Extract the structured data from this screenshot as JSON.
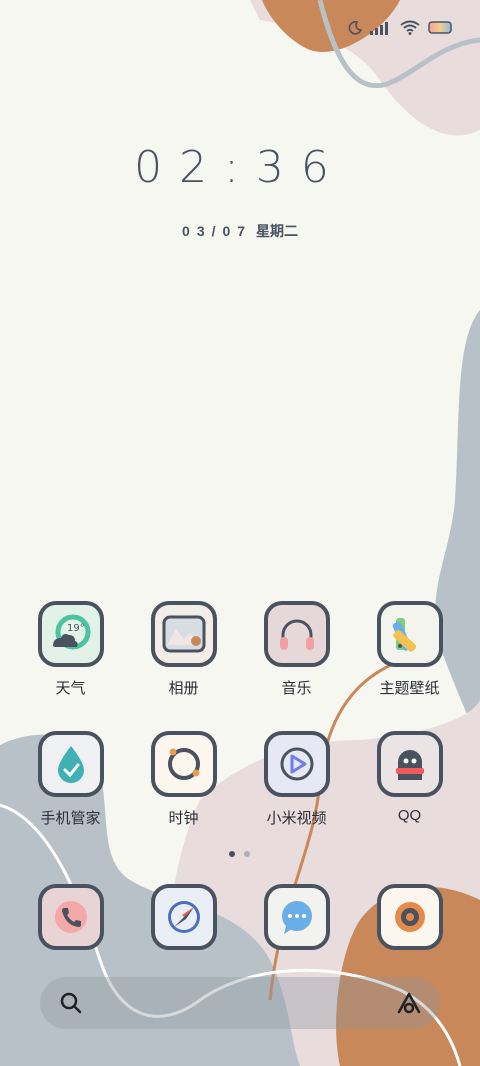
{
  "status_bar": {
    "icons": [
      "moon-icon",
      "signal-icon",
      "wifi-icon",
      "battery-icon"
    ]
  },
  "lock_clock": {
    "time": "02:36",
    "date": "03/07",
    "weekday": "星期二"
  },
  "home_apps": [
    {
      "label": "天气",
      "icon": "weather-icon",
      "badge": "19°"
    },
    {
      "label": "相册",
      "icon": "gallery-icon"
    },
    {
      "label": "音乐",
      "icon": "headphones-icon"
    },
    {
      "label": "主题壁纸",
      "icon": "themes-icon"
    },
    {
      "label": "手机管家",
      "icon": "security-drop-icon"
    },
    {
      "label": "时钟",
      "icon": "clock-icon"
    },
    {
      "label": "小米视频",
      "icon": "video-play-icon"
    },
    {
      "label": "QQ",
      "icon": "qq-penguin-icon"
    }
  ],
  "page_indicator": {
    "pages": 2,
    "current": 1
  },
  "dock": [
    {
      "icon": "phone-icon"
    },
    {
      "icon": "compass-browser-icon"
    },
    {
      "icon": "message-icon"
    },
    {
      "icon": "camera-icon"
    }
  ],
  "search_bar": {
    "icons": [
      "search-icon",
      "assistant-icon"
    ]
  },
  "colors": {
    "background": "#f7f7f2",
    "blob_orange": "#c8885a",
    "blob_pink": "#e8dcdc",
    "blob_gray": "#b9c1c8",
    "icon_outline": "#4a5260"
  }
}
